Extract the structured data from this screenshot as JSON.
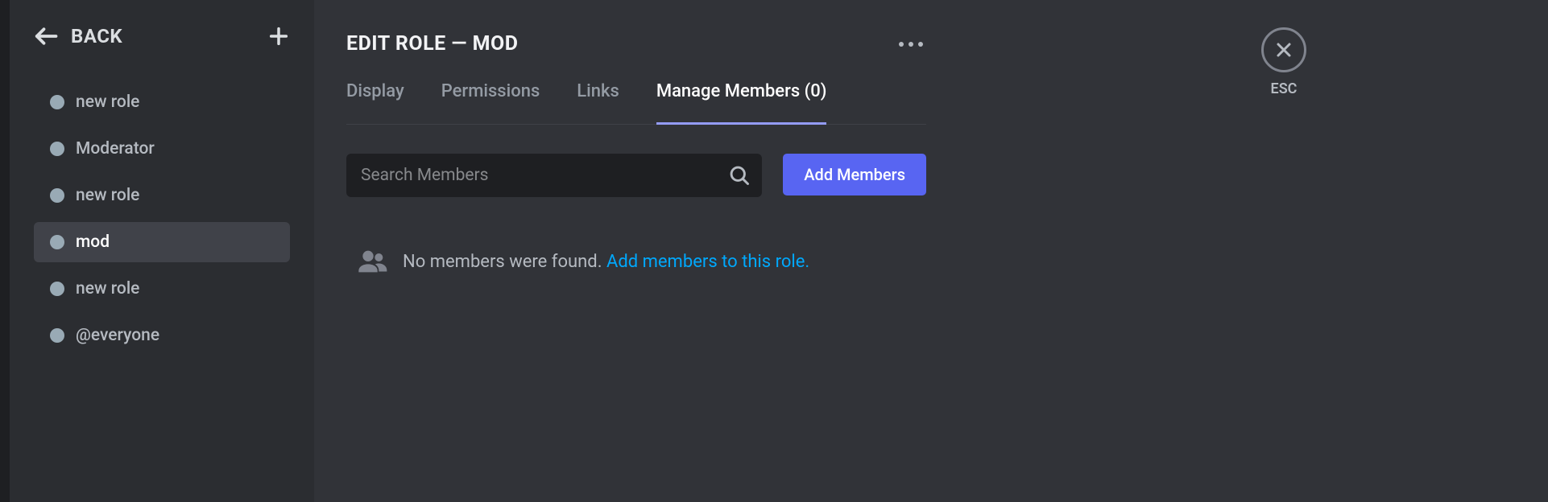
{
  "sidebar": {
    "back_label": "BACK",
    "roles": [
      {
        "label": "new role",
        "selected": false
      },
      {
        "label": "Moderator",
        "selected": false
      },
      {
        "label": "new role",
        "selected": false
      },
      {
        "label": "mod",
        "selected": true
      },
      {
        "label": "new role",
        "selected": false
      },
      {
        "label": "@everyone",
        "selected": false
      }
    ]
  },
  "main": {
    "title": "EDIT ROLE — MOD",
    "tabs": [
      {
        "label": "Display",
        "active": false
      },
      {
        "label": "Permissions",
        "active": false
      },
      {
        "label": "Links",
        "active": false
      },
      {
        "label": "Manage Members (0)",
        "active": true
      }
    ],
    "search_placeholder": "Search Members",
    "add_members_label": "Add Members",
    "empty_state_text": "No members were found.",
    "empty_state_link": "Add members to this role."
  },
  "close": {
    "esc_label": "ESC"
  }
}
